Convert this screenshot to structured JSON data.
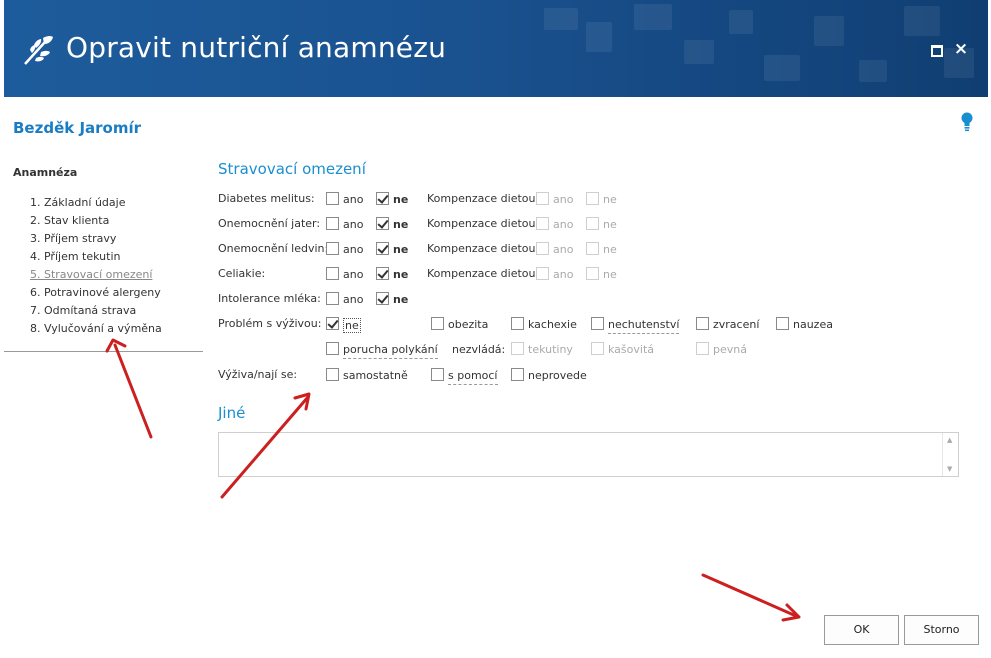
{
  "window": {
    "title": "Opravit nutriční anamnézu",
    "maximize_label": "",
    "close_label": "×"
  },
  "patient": {
    "name": "Bezděk Jaromír"
  },
  "sidebar": {
    "title": "Anamnéza",
    "items": [
      {
        "label": "1. Základní údaje"
      },
      {
        "label": "2. Stav klienta"
      },
      {
        "label": "3. Příjem stravy"
      },
      {
        "label": "4. Příjem tekutin"
      },
      {
        "label": "5. Stravovací omezení"
      },
      {
        "label": "6. Potravinové alergeny"
      },
      {
        "label": "7. Odmítaná strava"
      },
      {
        "label": "8. Vylučování a výměna"
      }
    ]
  },
  "section": {
    "title": "Stravovací omezení",
    "rows": [
      {
        "label": "Diabetes melitus:",
        "ano": "ano",
        "ne": "ne",
        "komp_label": "Kompenzace dietou:",
        "komp_ano": "ano",
        "komp_ne": "ne"
      },
      {
        "label": "Onemocnění jater:",
        "ano": "ano",
        "ne": "ne",
        "komp_label": "Kompenzace dietou:",
        "komp_ano": "ano",
        "komp_ne": "ne"
      },
      {
        "label": "Onemocnění ledvin:",
        "ano": "ano",
        "ne": "ne",
        "komp_label": "Kompenzace dietou:",
        "komp_ano": "ano",
        "komp_ne": "ne"
      },
      {
        "label": "Celiakie:",
        "ano": "ano",
        "ne": "ne",
        "komp_label": "Kompenzace dietou:",
        "komp_ano": "ano",
        "komp_ne": "ne"
      },
      {
        "label": "Intolerance mléka:",
        "ano": "ano",
        "ne": "ne"
      }
    ],
    "problem": {
      "label": "Problém s výživou:",
      "options": [
        "ne",
        "obezita",
        "kachexie",
        "nechutenství",
        "zvracení",
        "nauzea"
      ],
      "porucha": "porucha polykání",
      "nezvlada_label": "nezvládá:",
      "nezvlada_options": [
        "tekutiny",
        "kašovitá",
        "pevná"
      ]
    },
    "vyziva": {
      "label": "Výživa/nají se:",
      "options": [
        "samostatně",
        "s pomocí",
        "neprovede"
      ]
    }
  },
  "other": {
    "title": "Jiné",
    "value": ""
  },
  "buttons": {
    "ok": "OK",
    "storno": "Storno"
  },
  "colors": {
    "header": "#1a5290",
    "accent": "#1a8fd0",
    "arrow": "#cc1f1f"
  }
}
